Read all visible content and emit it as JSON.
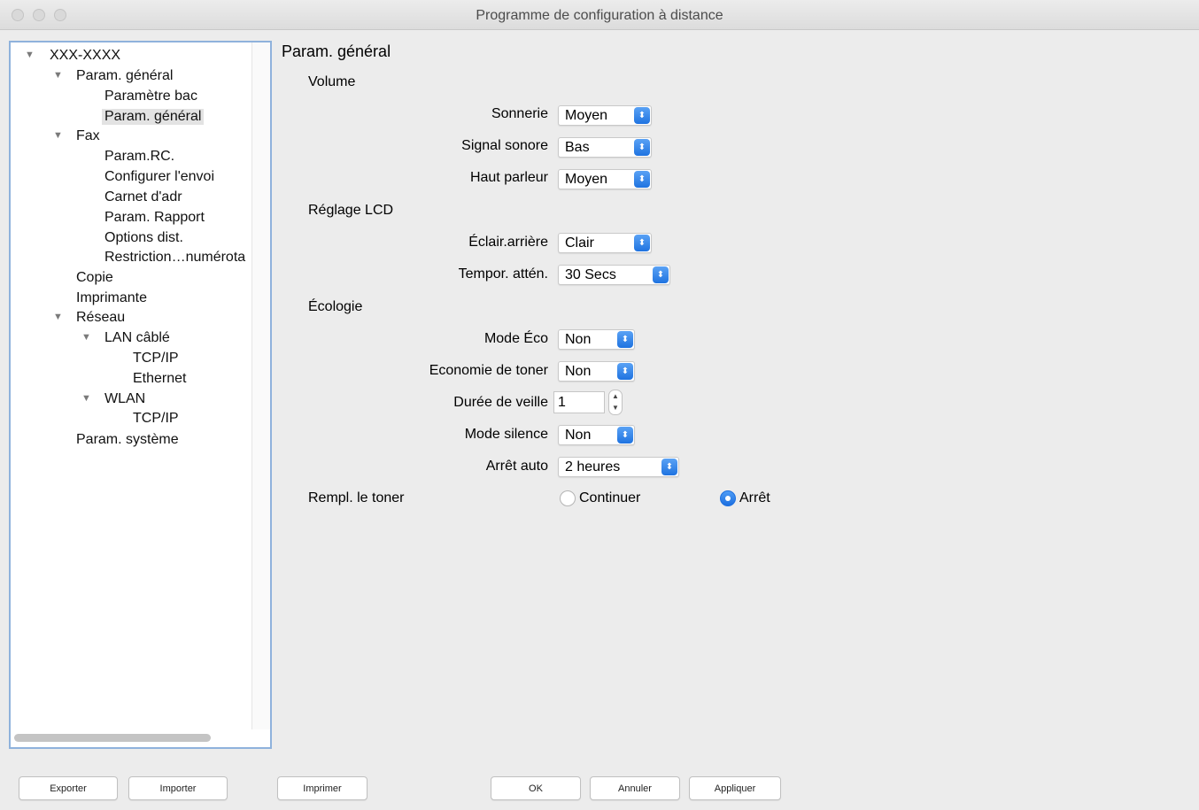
{
  "window": {
    "title": "Programme de configuration à distance"
  },
  "tree": {
    "root": "XXX-XXXX",
    "param_general": "Param. général",
    "parametre_bac": "Paramètre bac",
    "param_general_child": "Param. général",
    "fax": "Fax",
    "param_rc": "Param.RC.",
    "configurer_envoi": "Configurer l'envoi",
    "carnet_adr": "Carnet d'adr",
    "param_rapport": "Param. Rapport",
    "options_dist": "Options dist.",
    "restriction": "Restriction…numérota",
    "copie": "Copie",
    "imprimante": "Imprimante",
    "reseau": "Réseau",
    "lan_cable": "LAN câblé",
    "tcpip_lan": "TCP/IP",
    "ethernet": "Ethernet",
    "wlan": "WLAN",
    "tcpip_wlan": "TCP/IP",
    "param_systeme": "Param. système"
  },
  "main": {
    "title": "Param. général",
    "volume": {
      "heading": "Volume",
      "sonnerie_label": "Sonnerie",
      "sonnerie_value": "Moyen",
      "signal_label": "Signal sonore",
      "signal_value": "Bas",
      "haut_parleur_label": "Haut parleur",
      "haut_parleur_value": "Moyen"
    },
    "lcd": {
      "heading": "Réglage LCD",
      "eclair_label": "Éclair.arrière",
      "eclair_value": "Clair",
      "tempor_label": "Tempor. attén.",
      "tempor_value": "30 Secs"
    },
    "ecologie": {
      "heading": "Écologie",
      "mode_eco_label": "Mode Éco",
      "mode_eco_value": "Non",
      "economie_label": "Economie de toner",
      "economie_value": "Non",
      "duree_label": "Durée de veille",
      "duree_value": "1",
      "silence_label": "Mode silence",
      "silence_value": "Non",
      "arret_auto_label": "Arrêt auto",
      "arret_auto_value": "2 heures"
    },
    "toner": {
      "label": "Rempl. le toner",
      "option_continuer": "Continuer",
      "option_arret": "Arrêt",
      "selected": "Arrêt"
    }
  },
  "buttons": {
    "exporter": "Exporter",
    "importer": "Importer",
    "imprimer": "Imprimer",
    "ok": "OK",
    "annuler": "Annuler",
    "appliquer": "Appliquer"
  },
  "colors": {
    "accent": "#1f73e0",
    "selection": "#e3e3e3",
    "focus_border": "#8fb2dc"
  }
}
